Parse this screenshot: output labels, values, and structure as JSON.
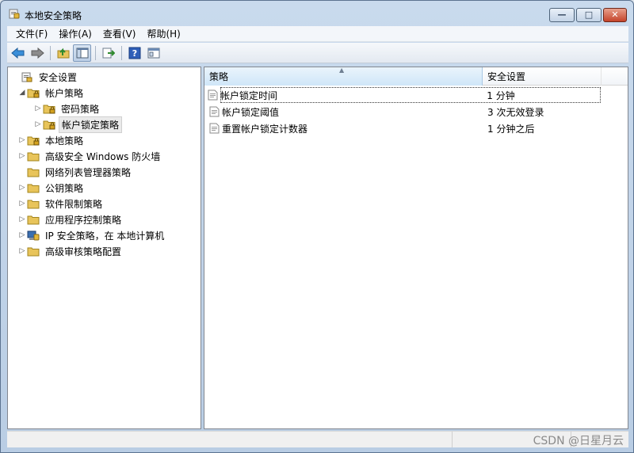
{
  "window": {
    "title": "本地安全策略"
  },
  "caption_buttons": {
    "minimize": "—",
    "maximize": "□",
    "close": "✕"
  },
  "menu": [
    "文件(F)",
    "操作(A)",
    "查看(V)",
    "帮助(H)"
  ],
  "toolbar": [
    "back-arrow",
    "forward-arrow",
    "up-folder",
    "show-hide-tree",
    "export-list",
    "help",
    "properties"
  ],
  "tree": [
    {
      "label": "安全设置",
      "level": 0,
      "arrow": "",
      "icon": "security-settings-icon"
    },
    {
      "label": "帐户策略",
      "level": 1,
      "arrow": "◢",
      "icon": "folder-lock-icon"
    },
    {
      "label": "密码策略",
      "level": 2,
      "arrow": "▷",
      "icon": "folder-lock-icon"
    },
    {
      "label": "帐户锁定策略",
      "level": 2,
      "arrow": "▷",
      "icon": "folder-lock-icon",
      "selected": true
    },
    {
      "label": "本地策略",
      "level": 1,
      "arrow": "▷",
      "icon": "folder-lock-icon"
    },
    {
      "label": "高级安全 Windows 防火墙",
      "level": 1,
      "arrow": "▷",
      "icon": "folder-icon"
    },
    {
      "label": "网络列表管理器策略",
      "level": 1,
      "arrow": "",
      "icon": "folder-icon"
    },
    {
      "label": "公钥策略",
      "level": 1,
      "arrow": "▷",
      "icon": "folder-icon"
    },
    {
      "label": "软件限制策略",
      "level": 1,
      "arrow": "▷",
      "icon": "folder-icon"
    },
    {
      "label": "应用程序控制策略",
      "level": 1,
      "arrow": "▷",
      "icon": "folder-icon"
    },
    {
      "label": "IP 安全策略，在 本地计算机",
      "level": 1,
      "arrow": "▷",
      "icon": "ipsec-icon"
    },
    {
      "label": "高级审核策略配置",
      "level": 1,
      "arrow": "▷",
      "icon": "folder-icon"
    }
  ],
  "list": {
    "columns": [
      "策略",
      "安全设置"
    ],
    "rows": [
      {
        "policy": "帐户锁定时间",
        "setting": "1 分钟",
        "focused": true
      },
      {
        "policy": "帐户锁定阈值",
        "setting": "3 次无效登录"
      },
      {
        "policy": "重置帐户锁定计数器",
        "setting": "1 分钟之后"
      }
    ]
  },
  "watermark": "CSDN @日星月云",
  "colors": {
    "title_bar": "#c9daed",
    "close_button": "#c4442a",
    "column_header_sorted": "#cfe6f8",
    "folder": "#e8c45a"
  }
}
